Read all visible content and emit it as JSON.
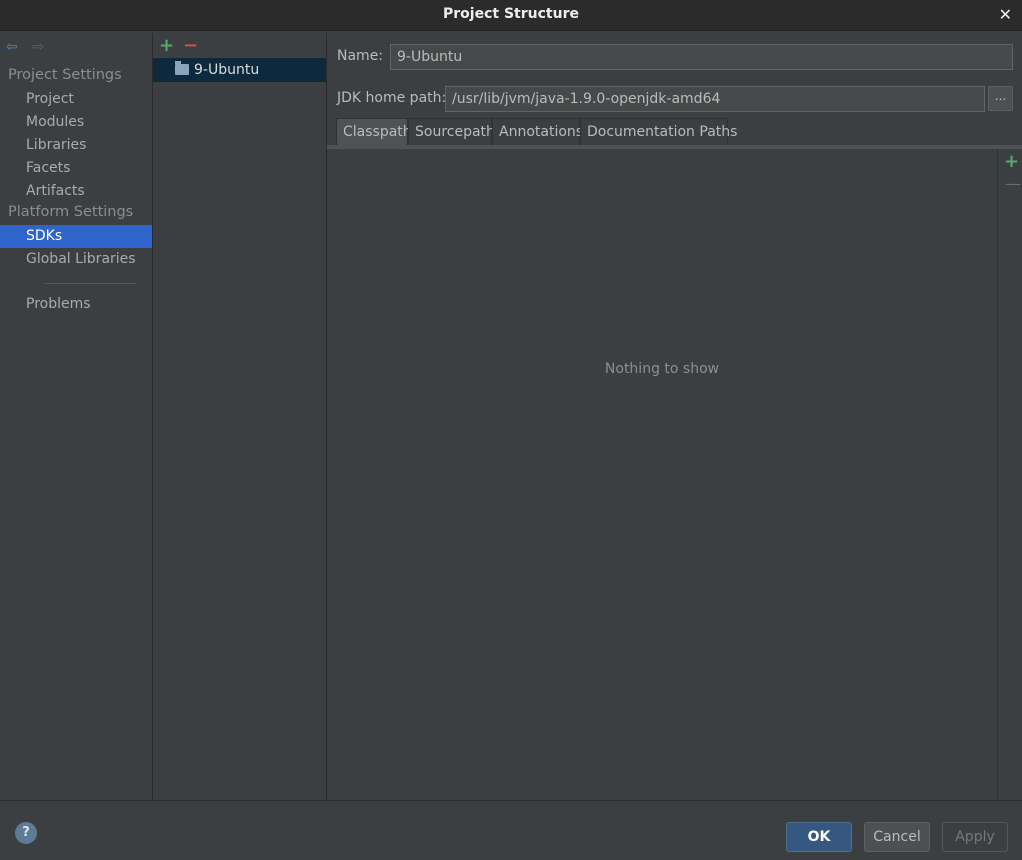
{
  "window": {
    "title": "Project Structure",
    "close_glyph": "✕"
  },
  "nav": {
    "back_icon": "⇦",
    "forward_icon": "⇨",
    "project_settings_label": "Project Settings",
    "project_settings_items": [
      "Project",
      "Modules",
      "Libraries",
      "Facets",
      "Artifacts"
    ],
    "platform_settings_label": "Platform Settings",
    "platform_settings_items": [
      "SDKs",
      "Global Libraries"
    ],
    "selected": "SDKs",
    "problems_label": "Problems"
  },
  "sdk_list": {
    "add_glyph": "+",
    "remove_glyph": "−",
    "items": [
      "9-Ubuntu"
    ]
  },
  "detail": {
    "name_label": "Name:",
    "name_value": "9-Ubuntu",
    "jdk_label": "JDK home path:",
    "jdk_value": "/usr/lib/jvm/java-1.9.0-openjdk-amd64",
    "browse_label": "...",
    "tabs": [
      "Classpath",
      "Sourcepath",
      "Annotations",
      "Documentation Paths"
    ],
    "active_tab": "Classpath",
    "empty_text": "Nothing to show",
    "add_glyph": "+",
    "remove_glyph": "—"
  },
  "footer": {
    "help_glyph": "?",
    "ok_label": "OK",
    "cancel_label": "Cancel",
    "apply_label": "Apply"
  },
  "colors": {
    "background": "#3c3f41",
    "selection": "#2f65ca",
    "list_selection": "#0d293e",
    "ok_button": "#365880",
    "add": "#59a869",
    "remove": "#c75450"
  }
}
